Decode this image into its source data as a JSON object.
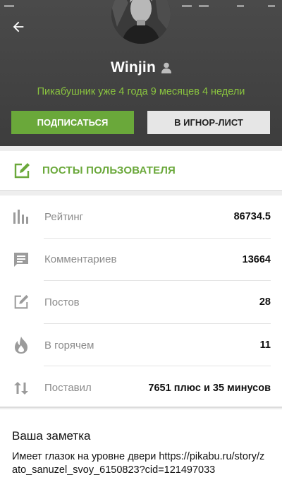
{
  "header": {
    "username": "Winjin",
    "membership": "Пикабушник уже 4 года 9 месяцев 4 недели",
    "subscribe_label": "ПОДПИСАТЬСЯ",
    "ignore_label": "В ИГНОР-ЛИСТ"
  },
  "posts_link": {
    "label": "ПОСТЫ ПОЛЬЗОВАТЕЛЯ"
  },
  "stats": [
    {
      "icon": "bar-chart-icon",
      "label": "Рейтинг",
      "value": "86734.5"
    },
    {
      "icon": "comment-icon",
      "label": "Комментариев",
      "value": "13664"
    },
    {
      "icon": "edit-icon",
      "label": "Постов",
      "value": "28"
    },
    {
      "icon": "fire-icon",
      "label": "В горячем",
      "value": "11"
    },
    {
      "icon": "swap-vertical-icon",
      "label": "Поставил",
      "value": "7651 плюс и 35 минусов"
    }
  ],
  "note": {
    "title": "Ваша заметка",
    "text": "Имеет глазок на уровне двери https://pikabu.ru/story/zato_sanuzel_svoy_6150823?cid=121497033"
  },
  "colors": {
    "accent": "#6aa83a",
    "header_bg": "#444444",
    "subline": "#8ac43f"
  }
}
